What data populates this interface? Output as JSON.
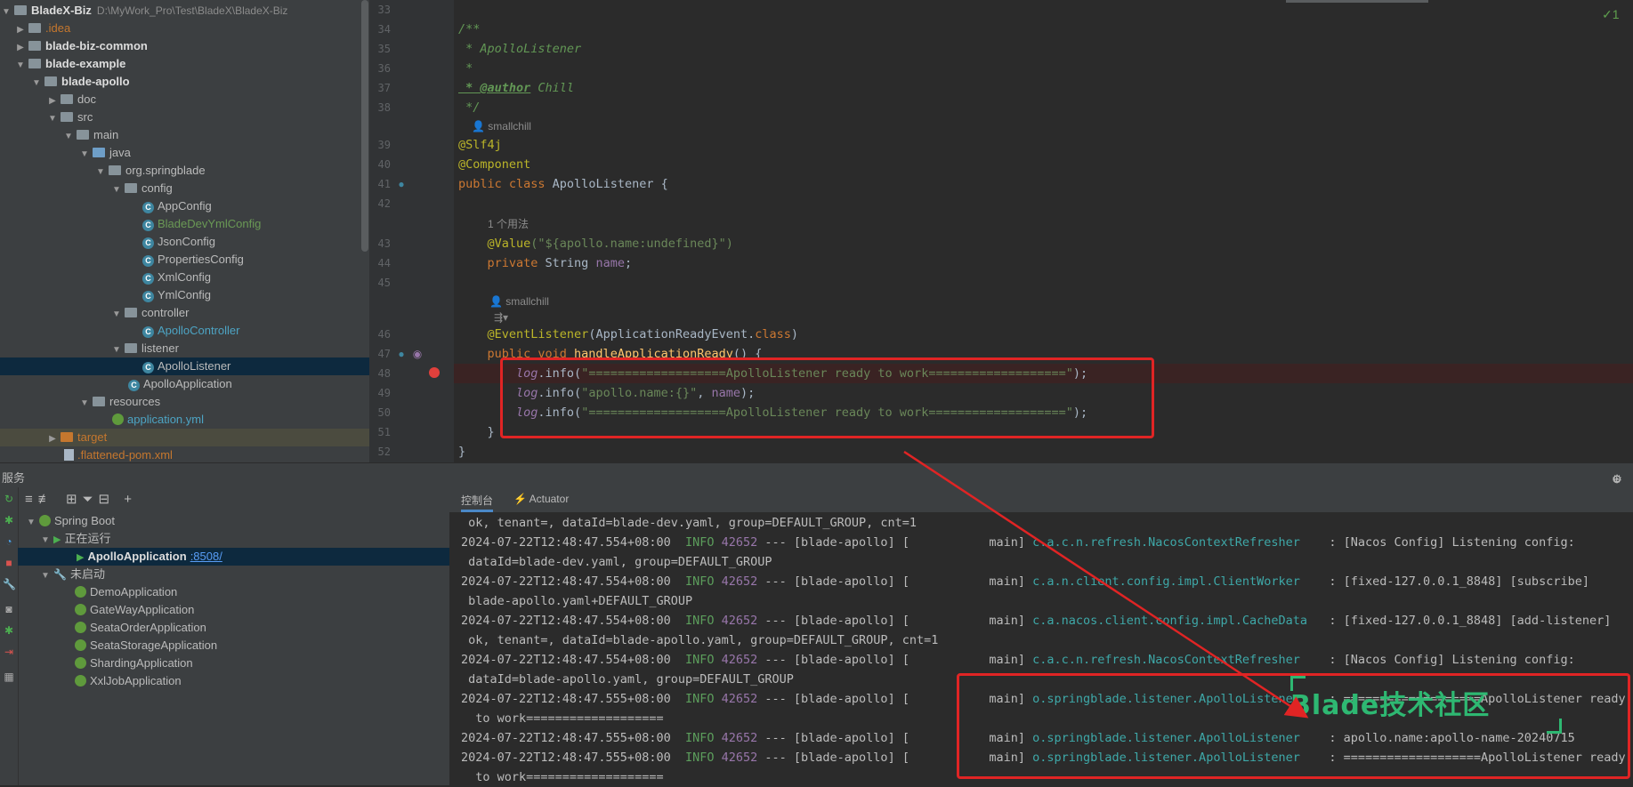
{
  "project": {
    "root_name": "BladeX-Biz",
    "root_path": "D:\\MyWork_Pro\\Test\\BladeX\\BladeX-Biz",
    "items": [
      {
        "label": ".idea"
      },
      {
        "label": "blade-biz-common"
      },
      {
        "label": "blade-example"
      },
      {
        "label": "blade-apollo"
      },
      {
        "label": "doc"
      },
      {
        "label": "src"
      },
      {
        "label": "main"
      },
      {
        "label": "java"
      },
      {
        "label": "org.springblade"
      },
      {
        "label": "config"
      },
      {
        "label": "AppConfig"
      },
      {
        "label": "BladeDevYmlConfig"
      },
      {
        "label": "JsonConfig"
      },
      {
        "label": "PropertiesConfig"
      },
      {
        "label": "XmlConfig"
      },
      {
        "label": "YmlConfig"
      },
      {
        "label": "controller"
      },
      {
        "label": "ApolloController"
      },
      {
        "label": "listener"
      },
      {
        "label": "ApolloListener"
      },
      {
        "label": "ApolloApplication"
      },
      {
        "label": "resources"
      },
      {
        "label": "application.yml"
      },
      {
        "label": "target"
      },
      {
        "label": ".flattened-pom.xml"
      }
    ]
  },
  "editor": {
    "line_numbers": [
      "33",
      "34",
      "35",
      "36",
      "37",
      "38",
      "39",
      "40",
      "41",
      "42",
      "43",
      "44",
      "45",
      "46",
      "47",
      "48",
      "49",
      "50",
      "51",
      "52"
    ],
    "hints": {
      "author1": "smallchill",
      "usages": "1 个用法",
      "author2": "smallchill"
    },
    "lines": {
      "l34": "/**",
      "l35": " * ApolloListener",
      "l36": " *",
      "l37_tag": " * @author",
      "l37_name": " Chill",
      "l38": " */",
      "l39": "@Slf4j",
      "l40": "@Component",
      "l41_kw": "public class",
      "l41_name": " ApolloListener {",
      "l43_ann": "    @Value",
      "l43_rest": "(\"${apollo.name:undefined}\")",
      "l44_kw": "    private",
      "l44_type": " String ",
      "l44_field": "name",
      "l44_end": ";",
      "l46_ann": "    @EventListener",
      "l46_rest": "(ApplicationReadyEvent.",
      "l46_kw": "class",
      "l46_end": ")",
      "l47_kw": "    public void",
      "l47_fn": " handleApplicationReady",
      "l47_end": "() {",
      "l48_log": "        log",
      "l48_mid": ".info(",
      "l48_str": "\"===================ApolloListener ready to work===================\"",
      "l48_end": ");",
      "l49_log": "        log",
      "l49_mid": ".info(",
      "l49_str": "\"apollo.name:{}\"",
      "l49_sep": ", ",
      "l49_field": "name",
      "l49_end": ");",
      "l50_log": "        log",
      "l50_mid": ".info(",
      "l50_str": "\"===================ApolloListener ready to work===================\"",
      "l50_end": ");",
      "l51": "    }",
      "l52": "}"
    }
  },
  "services": {
    "title": "服务",
    "spring_boot": "Spring Boot",
    "running": "正在运行",
    "active_app": "ApolloApplication",
    "active_port": ":8508/",
    "not_started": "未启动",
    "apps": [
      "DemoApplication",
      "GateWayApplication",
      "SeataOrderApplication",
      "SeataStorageApplication",
      "ShardingApplication",
      "XxlJobApplication"
    ]
  },
  "console": {
    "tabs": [
      "控制台",
      "Actuator"
    ],
    "lines": [
      {
        "text": " ok, tenant=, dataId=blade-dev.yaml, group=DEFAULT_GROUP, cnt=1"
      },
      {
        "ts": "2024-07-22T12:48:47.554+08:00",
        "lvl": "INFO",
        "pid": "42652",
        "mid": " --- [blade-apollo] [           main] ",
        "logger": "c.a.c.n.refresh.NacosContextRefresher   ",
        "msg": " : [Nacos Config] Listening config:"
      },
      {
        "text": " dataId=blade-dev.yaml, group=DEFAULT_GROUP"
      },
      {
        "ts": "2024-07-22T12:48:47.554+08:00",
        "lvl": "INFO",
        "pid": "42652",
        "mid": " --- [blade-apollo] [           main] ",
        "logger": "c.a.n.client.config.impl.ClientWorker   ",
        "msg": " : [fixed-127.0.0.1_8848] [subscribe]"
      },
      {
        "text": " blade-apollo.yaml+DEFAULT_GROUP"
      },
      {
        "ts": "2024-07-22T12:48:47.554+08:00",
        "lvl": "INFO",
        "pid": "42652",
        "mid": " --- [blade-apollo] [           main] ",
        "logger": "c.a.nacos.client.config.impl.CacheData  ",
        "msg": " : [fixed-127.0.0.1_8848] [add-listener]"
      },
      {
        "text": " ok, tenant=, dataId=blade-apollo.yaml, group=DEFAULT_GROUP, cnt=1"
      },
      {
        "ts": "2024-07-22T12:48:47.554+08:00",
        "lvl": "INFO",
        "pid": "42652",
        "mid": " --- [blade-apollo] [           main] ",
        "logger": "c.a.c.n.refresh.NacosContextRefresher   ",
        "msg": " : [Nacos Config] Listening config:"
      },
      {
        "text": " dataId=blade-apollo.yaml, group=DEFAULT_GROUP"
      },
      {
        "ts": "2024-07-22T12:48:47.555+08:00",
        "lvl": "INFO",
        "pid": "42652",
        "mid": " --- [blade-apollo] [           main] ",
        "logger": "o.springblade.listener.ApolloListener   ",
        "msg": " : ===================ApolloListener ready"
      },
      {
        "text": "  to work==================="
      },
      {
        "ts": "2024-07-22T12:48:47.555+08:00",
        "lvl": "INFO",
        "pid": "42652",
        "mid": " --- [blade-apollo] [           main] ",
        "logger": "o.springblade.listener.ApolloListener   ",
        "msg": " : apollo.name:apollo-name-20240715"
      },
      {
        "ts": "2024-07-22T12:48:47.555+08:00",
        "lvl": "INFO",
        "pid": "42652",
        "mid": " --- [blade-apollo] [           main] ",
        "logger": "o.springblade.listener.ApolloListener   ",
        "msg": " : ===================ApolloListener ready"
      },
      {
        "text": "  to work==================="
      }
    ]
  },
  "watermark": "Blade技术社区",
  "colors": {
    "highlight_box": "#e02424",
    "watermark": "#2eb872"
  }
}
